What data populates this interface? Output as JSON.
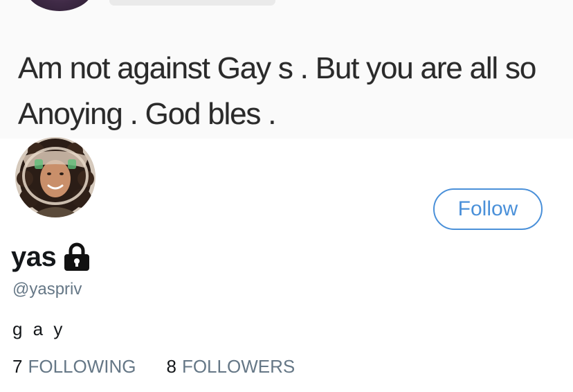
{
  "quoted_tweet": {
    "text": "Am not against Gay s . But you are all so Anoying . God bles ."
  },
  "profile": {
    "display_name": "yas",
    "handle": "@yaspriv",
    "bio": "g a y",
    "follow_label": "Follow",
    "following_count": "7",
    "following_label": "FOLLOWING",
    "followers_count": "8",
    "followers_label": "FOLLOWERS",
    "protected": true,
    "lock_icon": "lock-icon",
    "accent_color": "#4a90d9"
  }
}
